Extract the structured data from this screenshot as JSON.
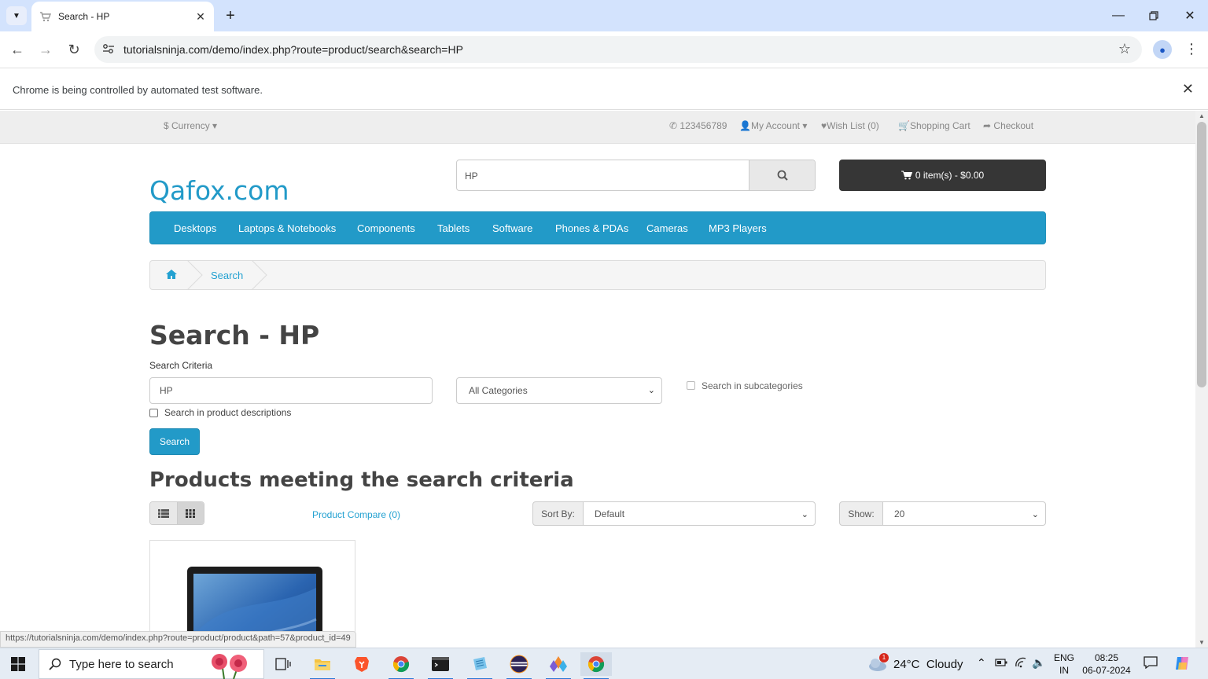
{
  "browser": {
    "tab_title": "Search - HP",
    "url": "tutorialsninja.com/demo/index.php?route=product/search&search=HP",
    "infobar_text": "Chrome is being controlled by automated test software.",
    "status_url": "https://tutorialsninja.com/demo/index.php?route=product/product&path=57&product_id=49"
  },
  "topbar": {
    "currency": "$ Currency",
    "phone": "123456789",
    "my_account": "My Account",
    "wish_list": "Wish List (0)",
    "shopping_cart": "Shopping Cart",
    "checkout": "Checkout"
  },
  "header": {
    "logo": "Qafox.com",
    "search_value": "HP",
    "cart_label": "0 item(s) - $0.00"
  },
  "menu": [
    "Desktops",
    "Laptops & Notebooks",
    "Components",
    "Tablets",
    "Software",
    "Phones & PDAs",
    "Cameras",
    "MP3 Players"
  ],
  "breadcrumb": {
    "current": "Search"
  },
  "search_page": {
    "title": "Search - HP",
    "criteria_label": "Search Criteria",
    "criteria_value": "HP",
    "category_selected": "All Categories",
    "subcategories_label": "Search in subcategories",
    "descriptions_label": "Search in product descriptions",
    "search_button": "Search",
    "results_title": "Products meeting the search criteria",
    "compare_link": "Product Compare (0)",
    "sort_label": "Sort By:",
    "sort_value": "Default",
    "show_label": "Show:",
    "show_value": "20"
  },
  "taskbar": {
    "search_placeholder": "Type here to search",
    "weather": "24°C  Cloudy",
    "weather_badge": "1",
    "lang_top": "ENG",
    "lang_bottom": "IN",
    "time": "08:25",
    "date": "06-07-2024"
  },
  "colors": {
    "accent": "#229ac8",
    "cart_dark": "#363636",
    "tab_strip": "#d3e3fd"
  }
}
